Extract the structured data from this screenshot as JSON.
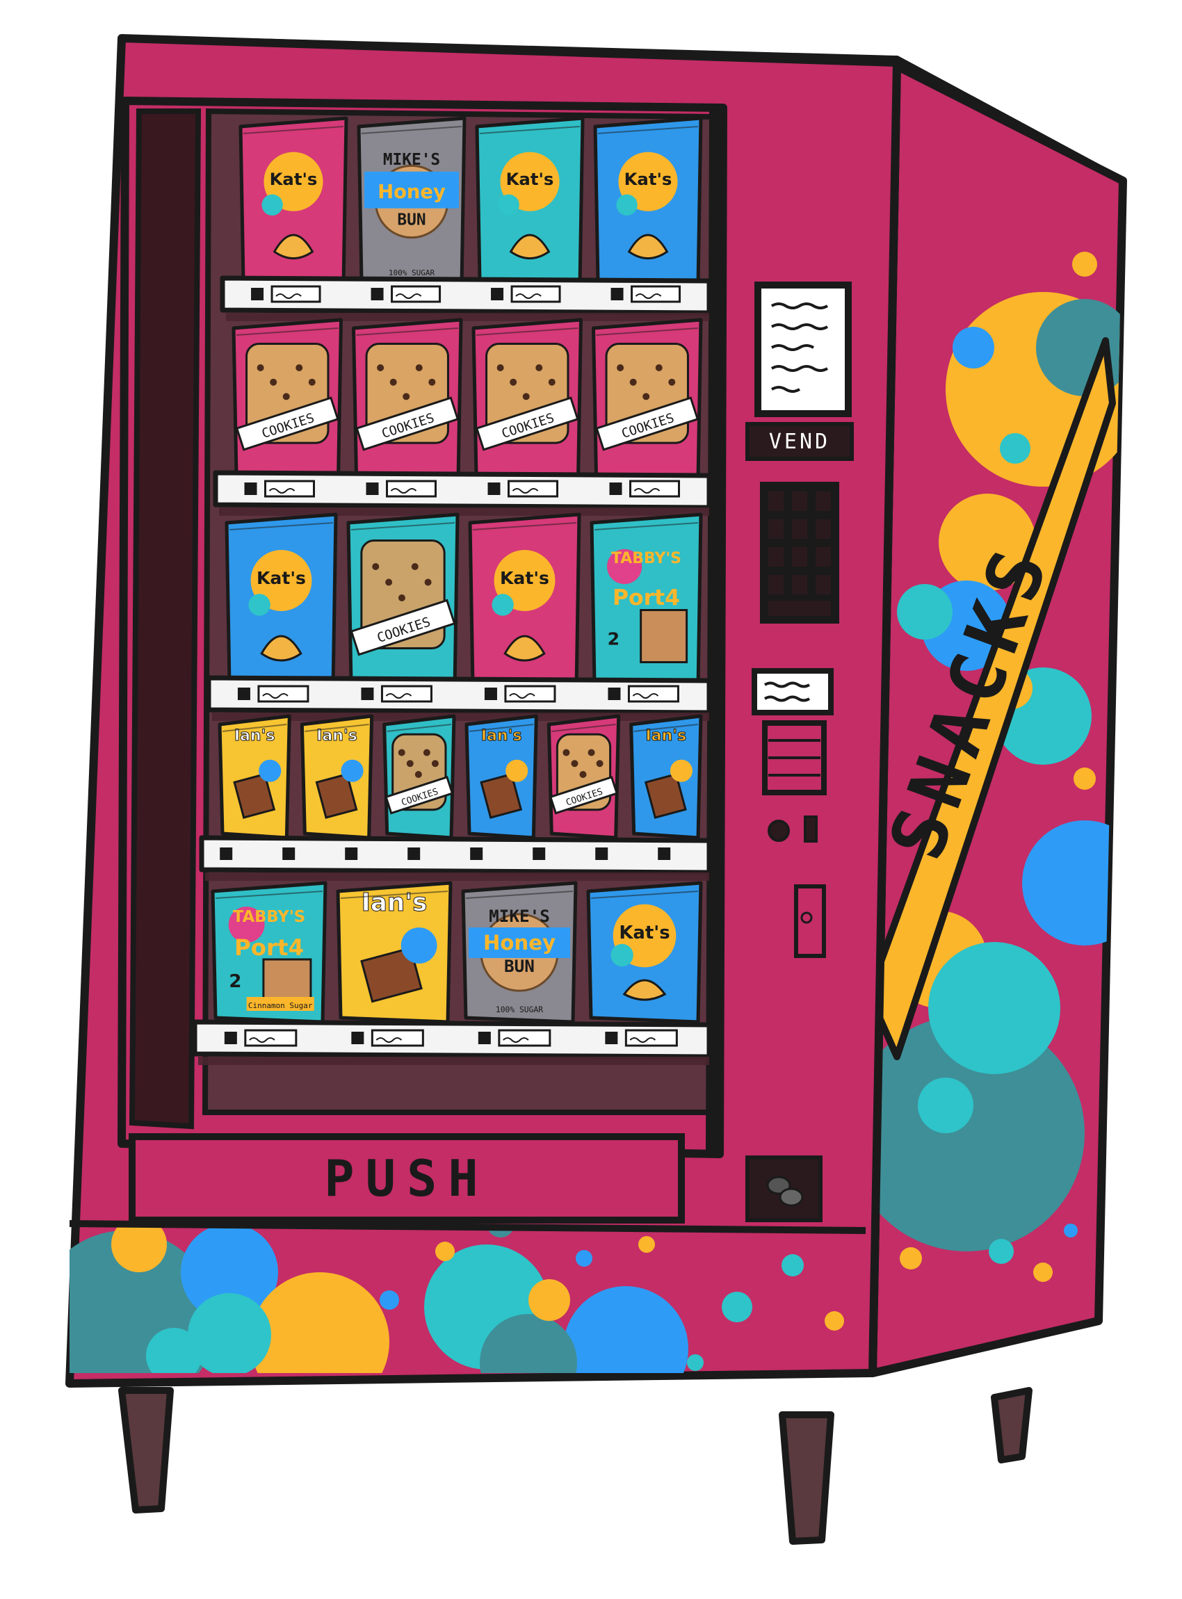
{
  "colors": {
    "body": "#c42d66",
    "bodyDark": "#a8204f",
    "outline": "#1a1a1a",
    "interior": "#4a2630",
    "interiorBack": "#5e3440",
    "glassShadow": "#3a1820",
    "shelf": "#f4f4f4",
    "leg": "#5a3a3e",
    "dotYellow": "#fbb62b",
    "dotTeal": "#2ec4c9",
    "dotBlue": "#2e9cf6",
    "dotDarkTeal": "#3f8f98",
    "sideBand": "#fbb62b"
  },
  "machine": {
    "push_label": "PUSH",
    "vend_label": "VEND",
    "side_label": "SNACKS"
  },
  "brands": {
    "kats": "Kat's",
    "mikes_line1": "MIKE'S",
    "mikes_line2": "Honey",
    "mikes_line3": "BUN",
    "mikes_sub": "100% SUGAR",
    "cookies": "COOKIES",
    "tabbys": "TABBY'S",
    "poptarts": "Port4",
    "poptarts_count": "2",
    "cinnamon": "Cinnamon Sugar",
    "ians": "Ian's"
  },
  "shelves": [
    {
      "row": 1,
      "items": [
        {
          "brand": "kats",
          "color": "pink"
        },
        {
          "brand": "mikes",
          "color": "gray"
        },
        {
          "brand": "kats",
          "color": "teal"
        },
        {
          "brand": "kats",
          "color": "blue"
        }
      ]
    },
    {
      "row": 2,
      "items": [
        {
          "brand": "cookies",
          "color": "pink"
        },
        {
          "brand": "cookies",
          "color": "pink"
        },
        {
          "brand": "cookies",
          "color": "pink"
        },
        {
          "brand": "cookies",
          "color": "pink"
        }
      ]
    },
    {
      "row": 3,
      "items": [
        {
          "brand": "kats",
          "color": "blue"
        },
        {
          "brand": "cookies",
          "color": "teal"
        },
        {
          "brand": "kats",
          "color": "pink"
        },
        {
          "brand": "tabbys",
          "color": "teal"
        }
      ]
    },
    {
      "row": 4,
      "items": [
        {
          "brand": "ians",
          "color": "yellow"
        },
        {
          "brand": "ians",
          "color": "yellow"
        },
        {
          "brand": "cookies",
          "color": "teal"
        },
        {
          "brand": "ians",
          "color": "blue"
        },
        {
          "brand": "cookies",
          "color": "pink"
        },
        {
          "brand": "ians",
          "color": "blue"
        }
      ]
    },
    {
      "row": 5,
      "items": [
        {
          "brand": "tabbys",
          "color": "teal"
        },
        {
          "brand": "ians",
          "color": "yellow"
        },
        {
          "brand": "mikes",
          "color": "gray"
        },
        {
          "brand": "kats",
          "color": "blue"
        }
      ]
    }
  ]
}
